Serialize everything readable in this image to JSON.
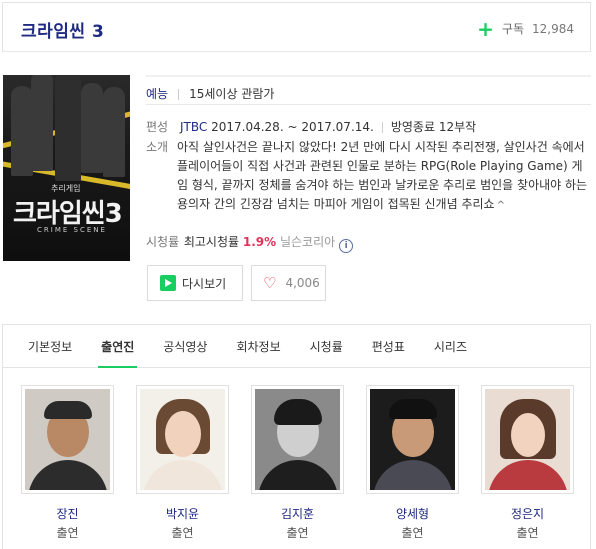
{
  "header": {
    "title": "크라임씬 3",
    "subscribe_label": "구독",
    "subscribe_count": "12,984"
  },
  "poster": {
    "title_text": "크라임씬3",
    "small_text": "추리게임",
    "crime_text": "CRIME SCENE"
  },
  "info": {
    "genre": "예능",
    "rating": "15세이상 관람가",
    "schedule_label": "편성",
    "channel": "JTBC",
    "period": "2017.04.28. ~ 2017.07.14.",
    "status": "방영종료 12부작",
    "intro_label": "소개",
    "intro_text": "아직 살인사건은 끝나지 않았다! 2년 만에 다시 시작된 추리전쟁, 살인사건 속에서 플레이어들이 직접 사건과 관련된 인물로 분하는 RPG(Role Playing Game) 게임 형식, 끝까지 정체를 숨겨야 하는 범인과 날카로운 추리로 범인을 찾아내야 하는 용의자 간의 긴장감 넘치는 마피아 게임이 접목된 신개념 추리쇼",
    "ratings_label": "시청률",
    "ratings_prefix": "최고시청률",
    "ratings_value": "1.9%",
    "ratings_source": "닐슨코리아"
  },
  "buttons": {
    "replay_label": "다시보기",
    "like_count": "4,006"
  },
  "tabs": [
    {
      "label": "기본정보"
    },
    {
      "label": "출연진"
    },
    {
      "label": "공식영상"
    },
    {
      "label": "회차정보"
    },
    {
      "label": "시청률"
    },
    {
      "label": "편성표"
    },
    {
      "label": "시리즈"
    }
  ],
  "active_tab": "출연진",
  "cast": [
    {
      "name": "장진",
      "role": "출연"
    },
    {
      "name": "박지윤",
      "role": "출연"
    },
    {
      "name": "김지훈",
      "role": "출연"
    },
    {
      "name": "양세형",
      "role": "출연"
    },
    {
      "name": "정은지",
      "role": "출연"
    }
  ],
  "colors": {
    "accent_green": "#19ce60",
    "title_blue": "#1f2a82",
    "rating_red": "#e0335a"
  }
}
